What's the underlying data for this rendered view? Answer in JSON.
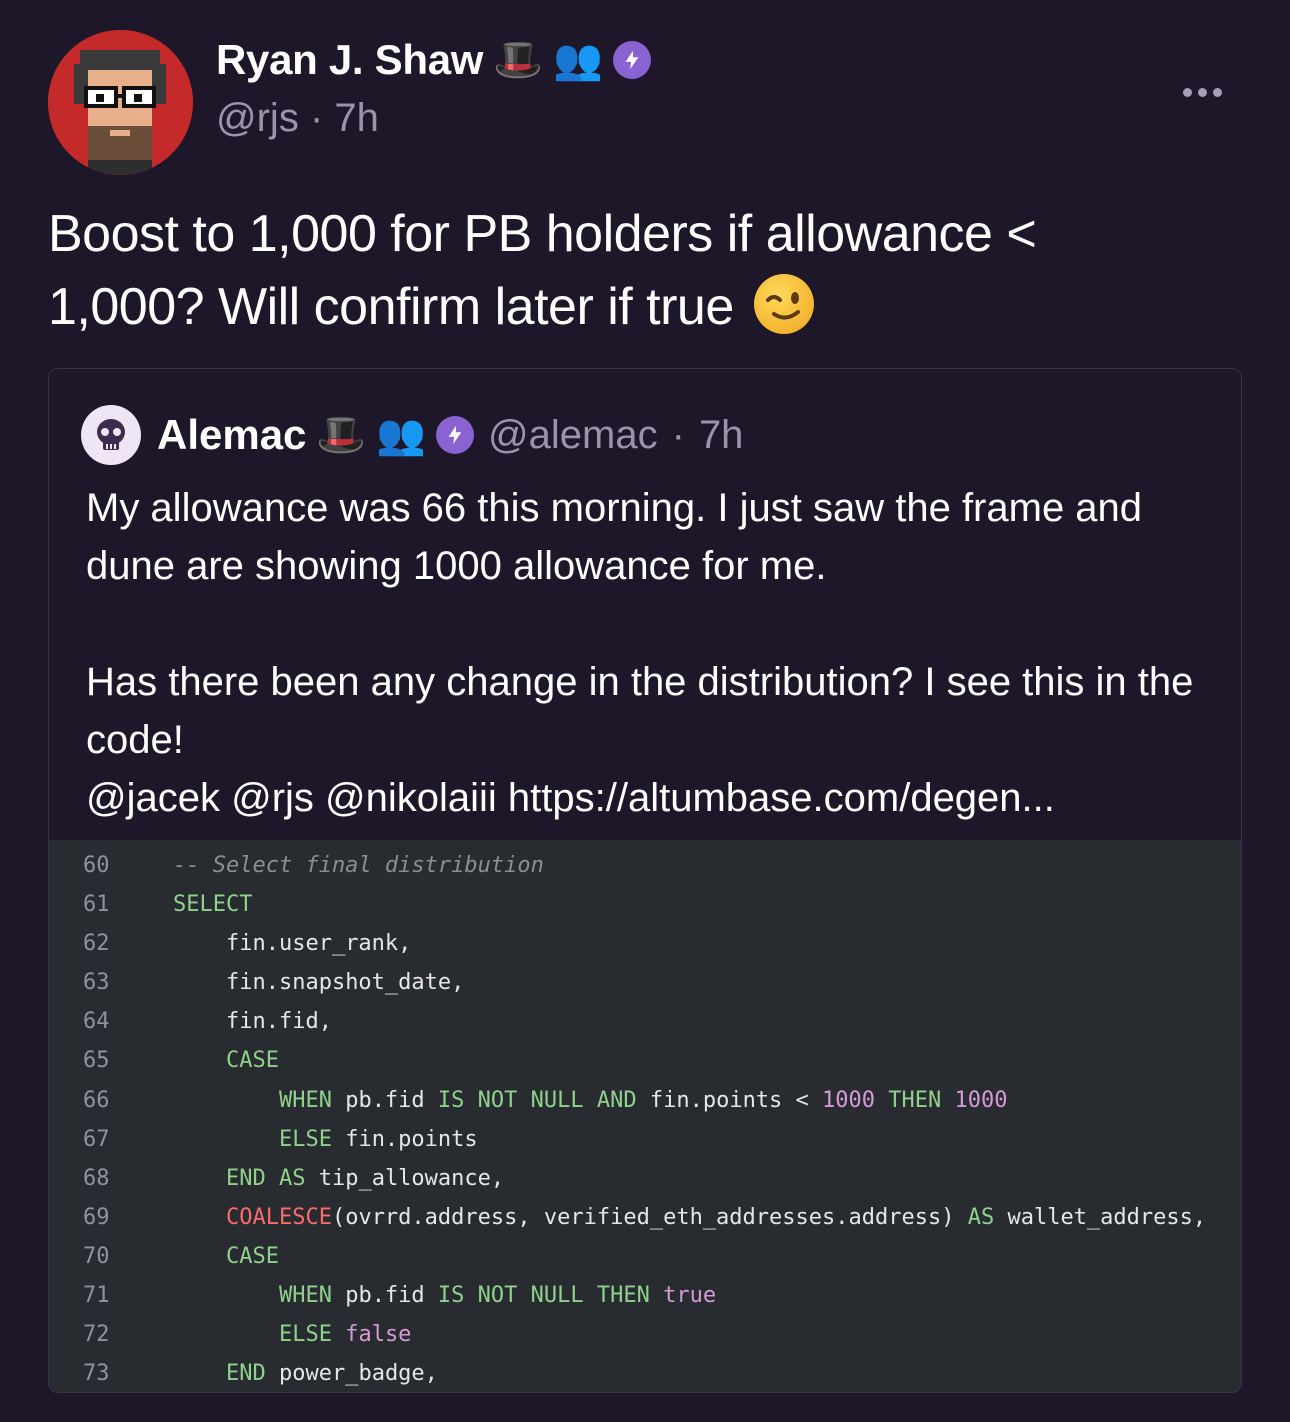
{
  "author": {
    "display_name": "Ryan J. Shaw",
    "emoji_hat": "🎩",
    "emoji_people": "👥",
    "handle": "@rjs",
    "separator": "·",
    "time": "7h"
  },
  "cast": {
    "text_main": "Boost to 1,000 for PB holders if allowance < 1,000? Will confirm later if true",
    "emoji": "😉"
  },
  "quote": {
    "display_name": "Alemac",
    "emoji_hat": "🎩",
    "emoji_people": "👥",
    "handle": "@alemac",
    "separator": "·",
    "time": "7h",
    "text": "My allowance was 66 this morning. I just saw the frame and dune are showing 1000 allowance for me.\n\nHas there been any change in the distribution? I see this in the code!\n@jacek @rjs @nikolaiii https://altumbase.com/degen..."
  },
  "code": {
    "lines": [
      {
        "n": "60",
        "indent": "",
        "tokens": [
          [
            "cmt",
            "-- Select final distribution"
          ]
        ]
      },
      {
        "n": "61",
        "indent": "",
        "tokens": [
          [
            "kw",
            "SELECT"
          ]
        ]
      },
      {
        "n": "62",
        "indent": "    ",
        "tokens": [
          [
            "",
            "fin.user_rank,"
          ]
        ]
      },
      {
        "n": "63",
        "indent": "    ",
        "tokens": [
          [
            "",
            "fin.snapshot_date,"
          ]
        ]
      },
      {
        "n": "64",
        "indent": "    ",
        "tokens": [
          [
            "",
            "fin.fid,"
          ]
        ]
      },
      {
        "n": "65",
        "indent": "    ",
        "tokens": [
          [
            "kw",
            "CASE"
          ]
        ]
      },
      {
        "n": "66",
        "indent": "        ",
        "tokens": [
          [
            "kw",
            "WHEN"
          ],
          [
            "",
            " pb.fid "
          ],
          [
            "kw",
            "IS NOT NULL AND"
          ],
          [
            "",
            " fin.points < "
          ],
          [
            "num",
            "1000"
          ],
          [
            "",
            " "
          ],
          [
            "kw",
            "THEN"
          ],
          [
            "",
            " "
          ],
          [
            "num",
            "1000"
          ]
        ]
      },
      {
        "n": "67",
        "indent": "        ",
        "tokens": [
          [
            "kw",
            "ELSE"
          ],
          [
            "",
            " fin.points"
          ]
        ]
      },
      {
        "n": "68",
        "indent": "    ",
        "tokens": [
          [
            "kw",
            "END AS"
          ],
          [
            "",
            " tip_allowance,"
          ]
        ]
      },
      {
        "n": "69",
        "indent": "    ",
        "tokens": [
          [
            "fn",
            "COALESCE"
          ],
          [
            "",
            "(ovrrd.address, verified_eth_addresses.address) "
          ],
          [
            "kw",
            "AS"
          ],
          [
            "",
            " wallet_address,"
          ]
        ]
      },
      {
        "n": "70",
        "indent": "    ",
        "tokens": [
          [
            "kw",
            "CASE"
          ]
        ]
      },
      {
        "n": "71",
        "indent": "        ",
        "tokens": [
          [
            "kw",
            "WHEN"
          ],
          [
            "",
            " pb.fid "
          ],
          [
            "kw",
            "IS NOT NULL THEN"
          ],
          [
            "",
            " "
          ],
          [
            "bool",
            "true"
          ]
        ]
      },
      {
        "n": "72",
        "indent": "        ",
        "tokens": [
          [
            "kw",
            "ELSE"
          ],
          [
            "",
            " "
          ],
          [
            "bool",
            "false"
          ]
        ]
      },
      {
        "n": "73",
        "indent": "    ",
        "tokens": [
          [
            "kw",
            "END"
          ],
          [
            "",
            " power_badge,"
          ]
        ]
      }
    ]
  },
  "icons": {
    "more": "more-options-icon",
    "power_badge": "power-badge-icon",
    "author_avatar": "avatar",
    "quote_avatar": "skull-avatar"
  },
  "colors": {
    "background": "#1e1729",
    "power_badge": "#8a63d2",
    "code_bg": "#282b30",
    "code_keyword": "#8fd28b",
    "code_number": "#d59bd6",
    "code_function": "#ff6b6b"
  }
}
